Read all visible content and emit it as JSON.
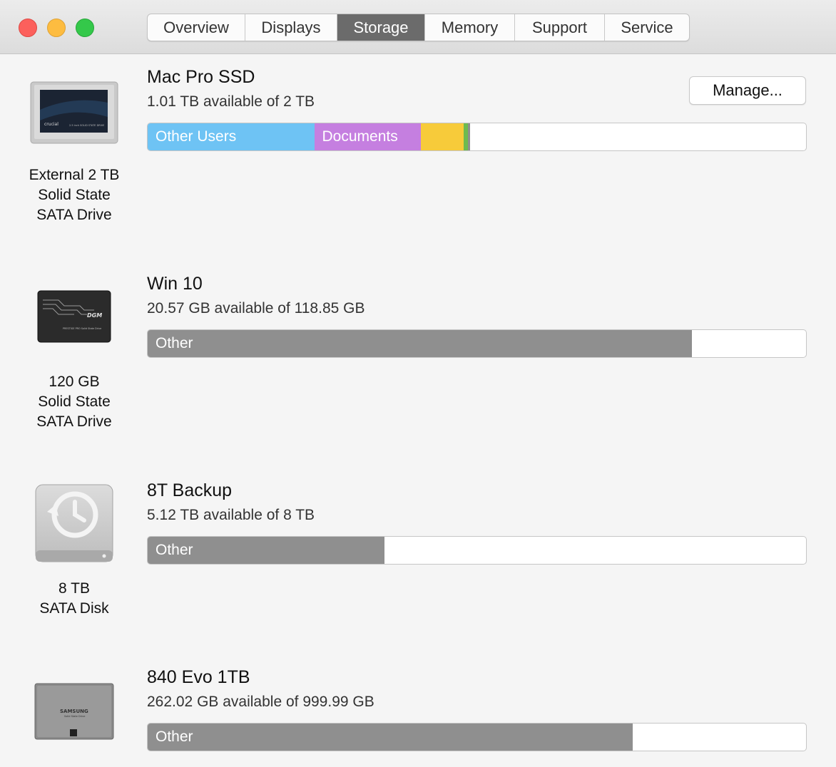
{
  "tabs": [
    {
      "label": "Overview"
    },
    {
      "label": "Displays"
    },
    {
      "label": "Storage",
      "active": true
    },
    {
      "label": "Memory"
    },
    {
      "label": "Support"
    },
    {
      "label": "Service"
    }
  ],
  "manage_label": "Manage...",
  "drives": [
    {
      "icon": "crucial-ssd-icon",
      "label": "External 2 TB\nSolid State\nSATA Drive",
      "icon_text": {
        "brand": "crucial",
        "model": "2.5 inch SOLID STATE DRIVE"
      },
      "name": "Mac Pro SSD",
      "available": "1.01 TB available of 2 TB",
      "segments": [
        {
          "label": "Other Users",
          "fraction": 0.253,
          "color": "#6ec3f4"
        },
        {
          "label": "Documents",
          "fraction": 0.162,
          "color": "#c57fe0"
        },
        {
          "label": "",
          "fraction": 0.065,
          "color": "#f7cb3a"
        },
        {
          "label": "",
          "fraction": 0.006,
          "color": "#6dbb4f"
        },
        {
          "label": "",
          "fraction": 0.004,
          "color": "#8e8e8e"
        }
      ]
    },
    {
      "icon": "dgm-ssd-icon",
      "label": "120 GB\nSolid State\nSATA Drive",
      "icon_text": {
        "brand": "DGM",
        "model": "PRESTIGE PRO Solid State Drive"
      },
      "name": "Win 10",
      "available": "20.57 GB available of 118.85 GB",
      "segments": [
        {
          "label": "Other",
          "fraction": 0.827,
          "color": "#8f8f8f"
        }
      ]
    },
    {
      "icon": "time-machine-disk-icon",
      "label": "8 TB\nSATA Disk",
      "name": "8T Backup",
      "available": "5.12 TB available of 8 TB",
      "segments": [
        {
          "label": "Other",
          "fraction": 0.36,
          "color": "#8f8f8f"
        }
      ]
    },
    {
      "icon": "samsung-ssd-icon",
      "label": "",
      "icon_text": {
        "brand": "SAMSUNG",
        "model": "Solid State Drive"
      },
      "name": "840 Evo 1TB",
      "available": "262.02 GB available of 999.99 GB",
      "segments": [
        {
          "label": "Other",
          "fraction": 0.737,
          "color": "#8f8f8f"
        }
      ]
    }
  ]
}
